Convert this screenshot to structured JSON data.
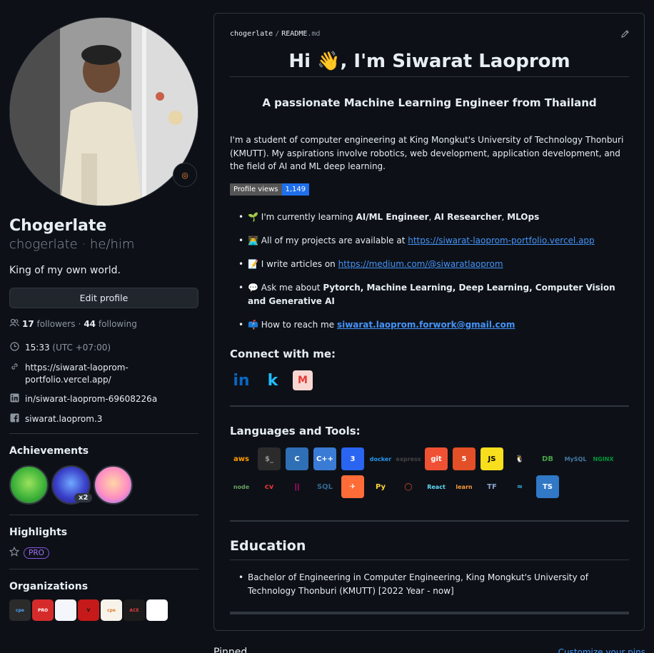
{
  "profile": {
    "name": "Chogerlate",
    "login": "chogerlate",
    "pronouns": "he/him",
    "login_line": "chogerlate · he/him",
    "bio": "King of my own world.",
    "edit_label": "Edit profile",
    "status_icon": "dart-emoji",
    "followers_count": "17",
    "followers_label": "followers",
    "following_count": "44",
    "following_label": "following",
    "time": "15:33",
    "timezone": "(UTC +07:00)",
    "website": "https://siwarat-laoprom-portfolio.vercel.app/",
    "linkedin": "in/siwarat-laoprom-69608226a",
    "facebook": "siwarat.laoprom.3"
  },
  "achievements": {
    "title": "Achievements",
    "items": [
      {
        "icon": "pair-extraordinaire-badge"
      },
      {
        "icon": "pull-shark-badge",
        "count": "x2"
      },
      {
        "icon": "yolo-badge"
      }
    ]
  },
  "highlights": {
    "title": "Highlights",
    "pro_label": "PRO"
  },
  "organizations": {
    "title": "Organizations",
    "items": [
      {
        "icon": "cpe-org",
        "text": "cpe",
        "bg": "#2b2b2b",
        "fg": "#4aa3ff"
      },
      {
        "icon": "pro-org",
        "text": "PRO",
        "bg": "#d62b2b",
        "fg": "#ffffff"
      },
      {
        "icon": "doc-org",
        "text": "",
        "bg": "#f4f6fb",
        "fg": "#3a6fd8"
      },
      {
        "icon": "v-org",
        "text": "V",
        "bg": "#c61a1a",
        "fg": "#111111"
      },
      {
        "icon": "cpe-color-org",
        "text": "cpe",
        "bg": "#f7f3ea",
        "fg": "#e07b2a"
      },
      {
        "icon": "ace-research-lab-org",
        "text": "ACE",
        "bg": "#1c1c1c",
        "fg": "#e23d3d"
      },
      {
        "icon": "gear-org",
        "text": "",
        "bg": "#ffffff",
        "fg": "#666666"
      }
    ]
  },
  "readme": {
    "path_user": "chogerlate",
    "path_sep": "/",
    "path_file": "README",
    "path_ext": ".md",
    "heading_before": "Hi ",
    "heading_emoji": "👋",
    "heading_after": ", I'm Siwarat Laoprom",
    "subtitle": "A passionate Machine Learning Engineer from Thailand",
    "intro": "I'm a student of computer engineering at King Mongkut's University of Technology Thonburi (KMUTT). My aspirations involve robotics, web development, application development, and the field of AI and ML deep learning.",
    "views_label": "Profile views",
    "views_count": "1,149",
    "bullets": {
      "learning_emoji": "🌱",
      "learning_text": "I'm currently learning ",
      "learning_1": "AI/ML Engineer",
      "learning_2": "AI Researcher",
      "learning_3": "MLOps",
      "comma": ", ",
      "projects_emoji": "👨‍💻",
      "projects_text": "All of my projects are available at ",
      "projects_link": "https://siwarat-laoprom-portfolio.vercel.app",
      "articles_emoji": "📝",
      "articles_text": "I write articles on ",
      "articles_link": "https://medium.com/@siwaratlaoprom",
      "ask_emoji": "💬",
      "ask_text": "Ask me about ",
      "ask_bold": "Pytorch, Machine Learning, Deep Learning, Computer Vision and Generative AI",
      "reach_emoji": "📫",
      "reach_text": "How to reach me ",
      "reach_email": "siwarat.laoprom.forwork@gmail.com"
    },
    "connect_title": "Connect with me:",
    "connect": [
      {
        "icon": "linkedin-icon",
        "text": "in",
        "fg": "#0a66c2",
        "bg": "transparent"
      },
      {
        "icon": "kaggle-icon",
        "text": "k",
        "fg": "#20beff",
        "bg": "transparent"
      },
      {
        "icon": "medium-icon",
        "text": "M",
        "fg": "#e53935",
        "bg": "#f8d7d3"
      }
    ],
    "tools_title": "Languages and Tools:",
    "tools": [
      {
        "icon": "aws-icon",
        "text": "aws",
        "bg": "transparent",
        "fg": "#f90"
      },
      {
        "icon": "bash-icon",
        "text": "$_",
        "bg": "#2b2b2b",
        "fg": "#999"
      },
      {
        "icon": "c-icon",
        "text": "C",
        "bg": "#2f6fb5",
        "fg": "#fff"
      },
      {
        "icon": "cplusplus-icon",
        "text": "C++",
        "bg": "#3a7bd5",
        "fg": "#fff"
      },
      {
        "icon": "css3-icon",
        "text": "3",
        "bg": "#2965f1",
        "fg": "#fff"
      },
      {
        "icon": "docker-icon",
        "text": "docker",
        "bg": "transparent",
        "fg": "#2496ed"
      },
      {
        "icon": "express-icon",
        "text": "express",
        "bg": "transparent",
        "fg": "#444"
      },
      {
        "icon": "git-icon",
        "text": "git",
        "bg": "#f05033",
        "fg": "#fff"
      },
      {
        "icon": "html5-icon",
        "text": "5",
        "bg": "#e34f26",
        "fg": "#fff"
      },
      {
        "icon": "javascript-icon",
        "text": "JS",
        "bg": "#f7df1e",
        "fg": "#000"
      },
      {
        "icon": "linux-icon",
        "text": "🐧",
        "bg": "transparent",
        "fg": "#fff"
      },
      {
        "icon": "mongodb-icon",
        "text": "DB",
        "bg": "transparent",
        "fg": "#47a248"
      },
      {
        "icon": "mysql-icon",
        "text": "MySQL",
        "bg": "transparent",
        "fg": "#4479a1"
      },
      {
        "icon": "nginx-icon",
        "text": "NGINX",
        "bg": "transparent",
        "fg": "#009639"
      },
      {
        "icon": "nodejs-icon",
        "text": "node",
        "bg": "transparent",
        "fg": "#68a063"
      },
      {
        "icon": "opencv-icon",
        "text": "cv",
        "bg": "transparent",
        "fg": "#e33"
      },
      {
        "icon": "pandas-icon",
        "text": "||",
        "bg": "transparent",
        "fg": "#e70488"
      },
      {
        "icon": "postgresql-icon",
        "text": "SQL",
        "bg": "transparent",
        "fg": "#336791"
      },
      {
        "icon": "postman-icon",
        "text": "✈",
        "bg": "#ff6c37",
        "fg": "#fff"
      },
      {
        "icon": "python-icon",
        "text": "Py",
        "bg": "transparent",
        "fg": "#ffd43b"
      },
      {
        "icon": "pytorch-icon",
        "text": "◯",
        "bg": "transparent",
        "fg": "#ee4c2c"
      },
      {
        "icon": "react-icon",
        "text": "React",
        "bg": "transparent",
        "fg": "#61dafb"
      },
      {
        "icon": "scikit-learn-icon",
        "text": "learn",
        "bg": "transparent",
        "fg": "#f89939"
      },
      {
        "icon": "tensorflow-icon",
        "text": "TF",
        "bg": "transparent",
        "fg": "#8aa4c8"
      },
      {
        "icon": "tailwind-icon",
        "text": "≈",
        "bg": "transparent",
        "fg": "#38bdf8"
      },
      {
        "icon": "typescript-icon",
        "text": "TS",
        "bg": "#3178c6",
        "fg": "#fff"
      }
    ],
    "education_title": "Education",
    "education": [
      "Bachelor of Engineering in Computer Engineering, King Mongkut's University of Technology Thonburi (KMUTT) [2022 Year - now]"
    ]
  },
  "footer": {
    "pinned": "Pinned",
    "customize": "Customize your pins"
  }
}
